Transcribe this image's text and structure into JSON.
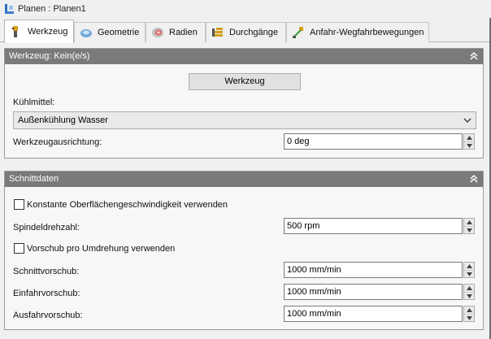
{
  "window": {
    "title": "Planen : Planen1",
    "icon": "operation-icon"
  },
  "tabs": [
    {
      "label": "Werkzeug",
      "icon": "tool-icon",
      "active": true
    },
    {
      "label": "Geometrie",
      "icon": "geometry-icon",
      "active": false
    },
    {
      "label": "Radien",
      "icon": "radii-icon",
      "active": false
    },
    {
      "label": "Durchgänge",
      "icon": "passes-icon",
      "active": false
    },
    {
      "label": "Anfahr-Wegfahrbewegungen",
      "icon": "linking-icon",
      "active": false
    }
  ],
  "tool_panel": {
    "header": "Werkzeug: Kein(e/s)",
    "select_tool_button": "Werkzeug",
    "coolant_label": "Kühlmittel:",
    "coolant_value": "Außenkühlung Wasser",
    "orientation_label": "Werkzeugausrichtung:",
    "orientation_value": "0 deg"
  },
  "cut_panel": {
    "header": "Schnittdaten",
    "constant_surface_speed_label": "Konstante Oberflächengeschwindigkeit verwenden",
    "constant_surface_speed_checked": false,
    "spindle_speed_label": "Spindeldrehzahl:",
    "spindle_speed_value": "500 rpm",
    "feed_per_rev_label": "Vorschub pro Umdrehung verwenden",
    "feed_per_rev_checked": false,
    "cutting_feed_label": "Schnittvorschub:",
    "cutting_feed_value": "1000 mm/min",
    "lead_in_feed_label": "Einfahrvorschub:",
    "lead_in_feed_value": "1000 mm/min",
    "lead_out_feed_label": "Ausfahrvorschub:",
    "lead_out_feed_value": "1000 mm/min"
  },
  "colors": {
    "panel_header": "#7a7a7a",
    "background": "#f0f0f0"
  }
}
